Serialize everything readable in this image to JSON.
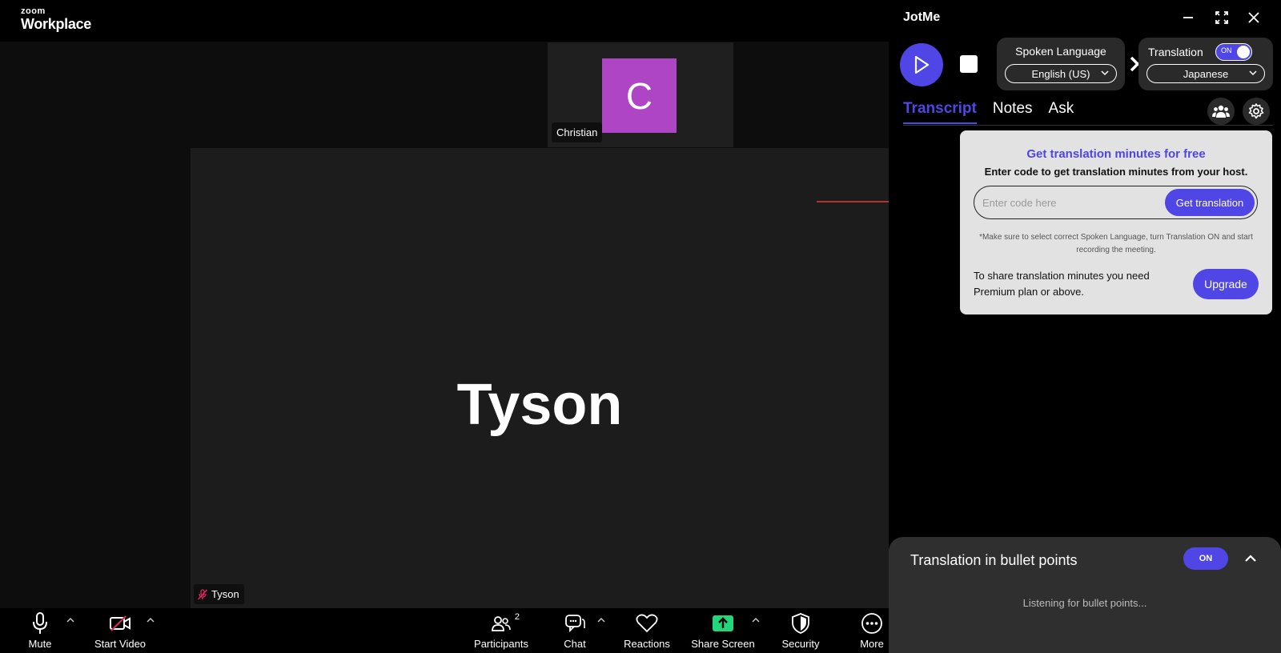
{
  "zoom": {
    "logo_small": "zoom",
    "logo_big": "Workplace",
    "thumbnail": {
      "avatar_letter": "C",
      "name": "Christian",
      "avatar_color": "#ad45c4"
    },
    "main_speaker": {
      "display_name": "Tyson",
      "label": "Tyson"
    },
    "toolbar": {
      "mute": "Mute",
      "start_video": "Start Video",
      "participants": "Participants",
      "participants_count": "2",
      "chat": "Chat",
      "reactions": "Reactions",
      "share_screen": "Share Screen",
      "security": "Security",
      "more": "More"
    }
  },
  "jotme": {
    "title": "JotMe",
    "accent": "#4f46e5",
    "spoken_language": {
      "label": "Spoken Language",
      "value": "English (US)"
    },
    "translation": {
      "label": "Translation",
      "toggle": "ON",
      "value": "Japanese"
    },
    "tabs": [
      "Transcript",
      "Notes",
      "Ask"
    ],
    "active_tab": "Transcript",
    "promo": {
      "title": "Get translation minutes for free",
      "subtitle": "Enter code to get translation minutes from your host.",
      "placeholder": "Enter code here",
      "button": "Get translation",
      "note": "*Make sure to select correct Spoken Language, turn Translation ON and start recording the meeting.",
      "share_text": "To share translation minutes you need Premium plan or above.",
      "upgrade": "Upgrade"
    },
    "bullet_panel": {
      "title": "Translation in bullet points",
      "toggle": "ON",
      "status": "Listening for bullet points..."
    }
  }
}
